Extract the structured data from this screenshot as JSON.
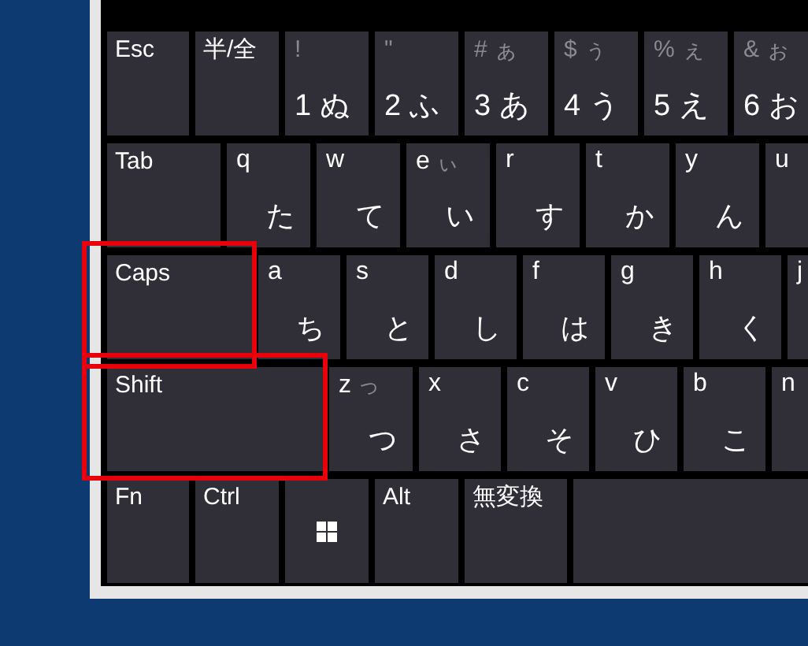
{
  "rows": [
    {
      "keys": [
        {
          "kind": "modifier",
          "label": "Esc",
          "highlighted": false
        },
        {
          "kind": "modifier",
          "label": "半/全",
          "highlighted": false
        },
        {
          "kind": "number",
          "symbol": "!",
          "digit": "1",
          "kana": "ぬ"
        },
        {
          "kind": "number",
          "symbol": "\"",
          "digit": "2",
          "kana": "ふ"
        },
        {
          "kind": "number",
          "symbol": "#",
          "shift_kana": "ぁ",
          "digit": "3",
          "kana": "あ"
        },
        {
          "kind": "number",
          "symbol": "$",
          "shift_kana": "ぅ",
          "digit": "4",
          "kana": "う"
        },
        {
          "kind": "number",
          "symbol": "%",
          "shift_kana": "ぇ",
          "digit": "5",
          "kana": "え"
        },
        {
          "kind": "number",
          "symbol": "&",
          "shift_kana": "ぉ",
          "digit": "6",
          "kana": "お"
        }
      ]
    },
    {
      "keys": [
        {
          "kind": "modifier",
          "label": "Tab",
          "highlighted": false
        },
        {
          "kind": "letter",
          "letter": "q",
          "kana": "た"
        },
        {
          "kind": "letter",
          "letter": "w",
          "kana": "て"
        },
        {
          "kind": "letter",
          "letter": "e",
          "shift_kana": "ぃ",
          "kana": "い"
        },
        {
          "kind": "letter",
          "letter": "r",
          "kana": "す"
        },
        {
          "kind": "letter",
          "letter": "t",
          "kana": "か"
        },
        {
          "kind": "letter",
          "letter": "y",
          "kana": "ん"
        },
        {
          "kind": "letter",
          "letter": "u"
        }
      ]
    },
    {
      "keys": [
        {
          "kind": "modifier",
          "label": "Caps",
          "highlighted": true
        },
        {
          "kind": "letter",
          "letter": "a",
          "kana": "ち"
        },
        {
          "kind": "letter",
          "letter": "s",
          "kana": "と"
        },
        {
          "kind": "letter",
          "letter": "d",
          "kana": "し"
        },
        {
          "kind": "letter",
          "letter": "f",
          "kana": "は"
        },
        {
          "kind": "letter",
          "letter": "g",
          "kana": "き"
        },
        {
          "kind": "letter",
          "letter": "h",
          "kana": "く"
        },
        {
          "kind": "letter",
          "letter": "j"
        }
      ]
    },
    {
      "keys": [
        {
          "kind": "modifier",
          "label": "Shift",
          "highlighted": true
        },
        {
          "kind": "letter",
          "letter": "z",
          "shift_kana": "っ",
          "kana": "つ"
        },
        {
          "kind": "letter",
          "letter": "x",
          "kana": "さ"
        },
        {
          "kind": "letter",
          "letter": "c",
          "kana": "そ"
        },
        {
          "kind": "letter",
          "letter": "v",
          "kana": "ひ"
        },
        {
          "kind": "letter",
          "letter": "b",
          "kana": "こ"
        },
        {
          "kind": "letter",
          "letter": "n"
        }
      ]
    },
    {
      "keys": [
        {
          "kind": "modifier",
          "label": "Fn",
          "highlighted": false
        },
        {
          "kind": "modifier",
          "label": "Ctrl",
          "highlighted": false
        },
        {
          "kind": "windows"
        },
        {
          "kind": "modifier",
          "label": "Alt",
          "highlighted": false
        },
        {
          "kind": "modifier",
          "label": "無変換",
          "highlighted": false
        },
        {
          "kind": "space"
        }
      ]
    }
  ]
}
